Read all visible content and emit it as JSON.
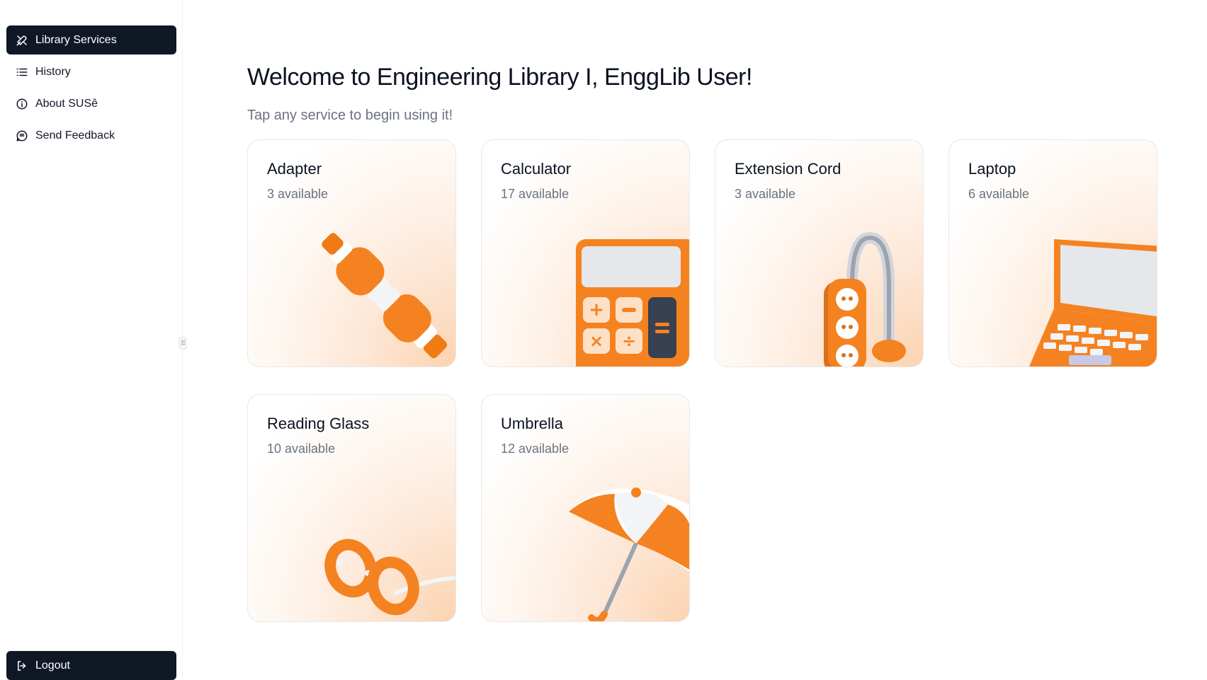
{
  "sidebar": {
    "items": [
      {
        "label": "Library Services",
        "icon": "tools-icon",
        "active": true
      },
      {
        "label": "History",
        "icon": "list-icon",
        "active": false
      },
      {
        "label": "About SUSê",
        "icon": "info-icon",
        "active": false
      },
      {
        "label": "Send Feedback",
        "icon": "chat-icon",
        "active": false
      }
    ],
    "logout_label": "Logout"
  },
  "main": {
    "title": "Welcome to Engineering Library I, EnggLib User!",
    "subtitle": "Tap any service to begin using it!",
    "services": [
      {
        "name": "Adapter",
        "availability": "3 available",
        "icon": "adapter-illustration"
      },
      {
        "name": "Calculator",
        "availability": "17 available",
        "icon": "calculator-illustration"
      },
      {
        "name": "Extension Cord",
        "availability": "3 available",
        "icon": "extension-cord-illustration"
      },
      {
        "name": "Laptop",
        "availability": "6 available",
        "icon": "laptop-illustration"
      },
      {
        "name": "Reading Glass",
        "availability": "10 available",
        "icon": "reading-glass-illustration"
      },
      {
        "name": "Umbrella",
        "availability": "12 available",
        "icon": "umbrella-illustration"
      }
    ]
  },
  "colors": {
    "accent": "#f58220",
    "sidebar_active_bg": "#101826",
    "text_muted": "#6b7280"
  }
}
